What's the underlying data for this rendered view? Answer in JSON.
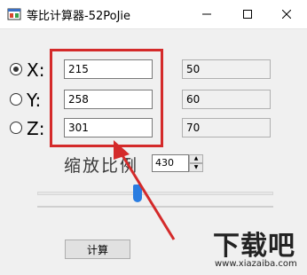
{
  "window": {
    "title": "等比计算器-52PoJie",
    "minimize_icon": "minimize-icon",
    "maximize_icon": "maximize-icon",
    "close_icon": "close-icon"
  },
  "coords": {
    "x": {
      "label": "X:",
      "input_value": "215",
      "result": "50",
      "checked": true
    },
    "y": {
      "label": "Y:",
      "input_value": "258",
      "result": "60",
      "checked": false
    },
    "z": {
      "label": "Z:",
      "input_value": "301",
      "result": "70",
      "checked": false
    }
  },
  "scale": {
    "label": "缩放比例",
    "value": "430",
    "up_glyph": "▲",
    "down_glyph": "▼"
  },
  "buttons": {
    "calculate": "计算"
  },
  "watermark": {
    "brand": "下载吧",
    "url": "www.xiazaiba.com"
  },
  "colors": {
    "highlight": "#d42a2a",
    "slider_thumb": "#2a7de1"
  }
}
